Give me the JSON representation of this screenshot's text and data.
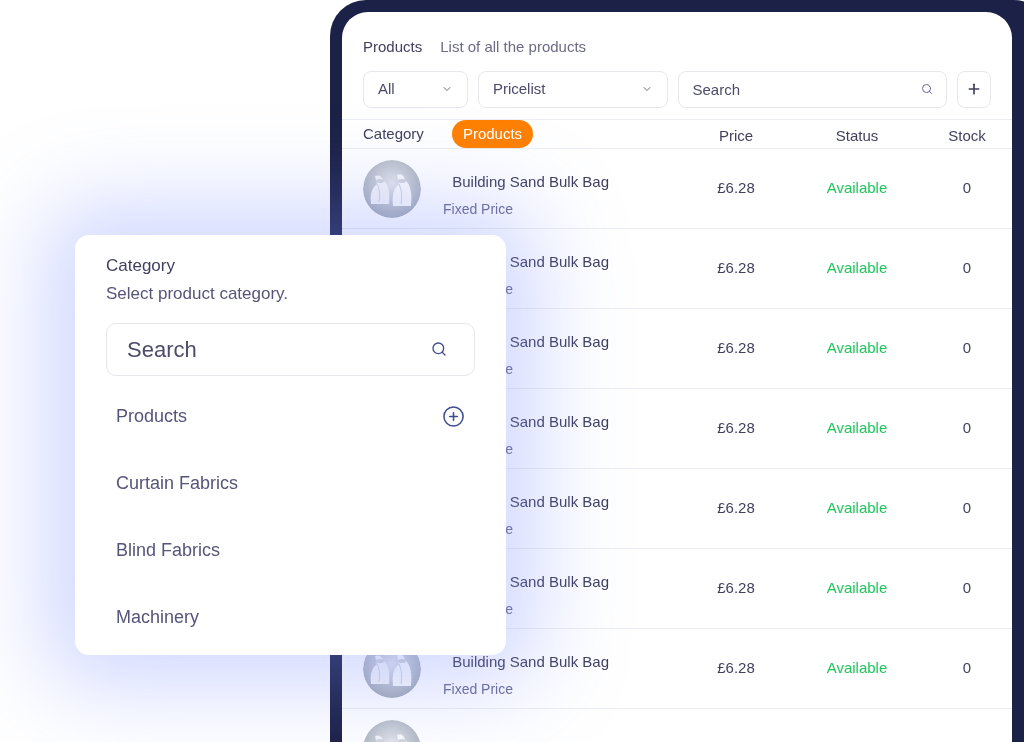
{
  "header": {
    "title": "Products",
    "subtitle": "List of all the products"
  },
  "filters": [
    {
      "kind": "dropdown",
      "label": "All"
    },
    {
      "kind": "dropdown",
      "label": "Pricelist"
    }
  ],
  "search": {
    "placeholder": "Search"
  },
  "table": {
    "category_label": "Category",
    "category_chip": "Products",
    "columns": [
      "Price",
      "Status",
      "Stock"
    ],
    "rows": [
      {
        "image": {
          "kind": "picture"
        },
        "name": "Building Sand Bulk Bag",
        "subtitle": "Fixed Price",
        "price": "£6.28",
        "status": "Available",
        "stock": "0"
      },
      {
        "name": "Sand Bulk Bag",
        "subtitle": "e",
        "price": "£6.28",
        "status": "Available",
        "stock": "0"
      },
      {
        "name": "Sand Bulk Bag",
        "subtitle": "e",
        "price": "£6.28",
        "status": "Available",
        "stock": "0"
      },
      {
        "name": "Sand Bulk Bag",
        "subtitle": "e",
        "price": "£6.28",
        "status": "Available",
        "stock": "0"
      },
      {
        "name": "Sand Bulk Bag",
        "subtitle": "e",
        "price": "£6.28",
        "status": "Available",
        "stock": "0"
      },
      {
        "name": "Sand Bulk Bag",
        "subtitle": "e",
        "price": "£6.28",
        "status": "Available",
        "stock": "0"
      },
      {
        "image": {
          "kind": "picture"
        },
        "name": "Building Sand Bulk Bag",
        "subtitle": "Fixed Price",
        "price": "£6.28",
        "status": "Available",
        "stock": "0"
      },
      {
        "image": {
          "kind": "picture"
        }
      }
    ]
  },
  "popover": {
    "title": "Category",
    "subtitle": "Select product category.",
    "search": {
      "placeholder": "Search"
    },
    "items": [
      {
        "label": "Products",
        "addable": true
      },
      {
        "label": "Curtain Fabrics",
        "addable": false
      },
      {
        "label": "Blind Fabrics",
        "addable": false
      },
      {
        "label": "Machinery",
        "addable": false
      }
    ]
  }
}
